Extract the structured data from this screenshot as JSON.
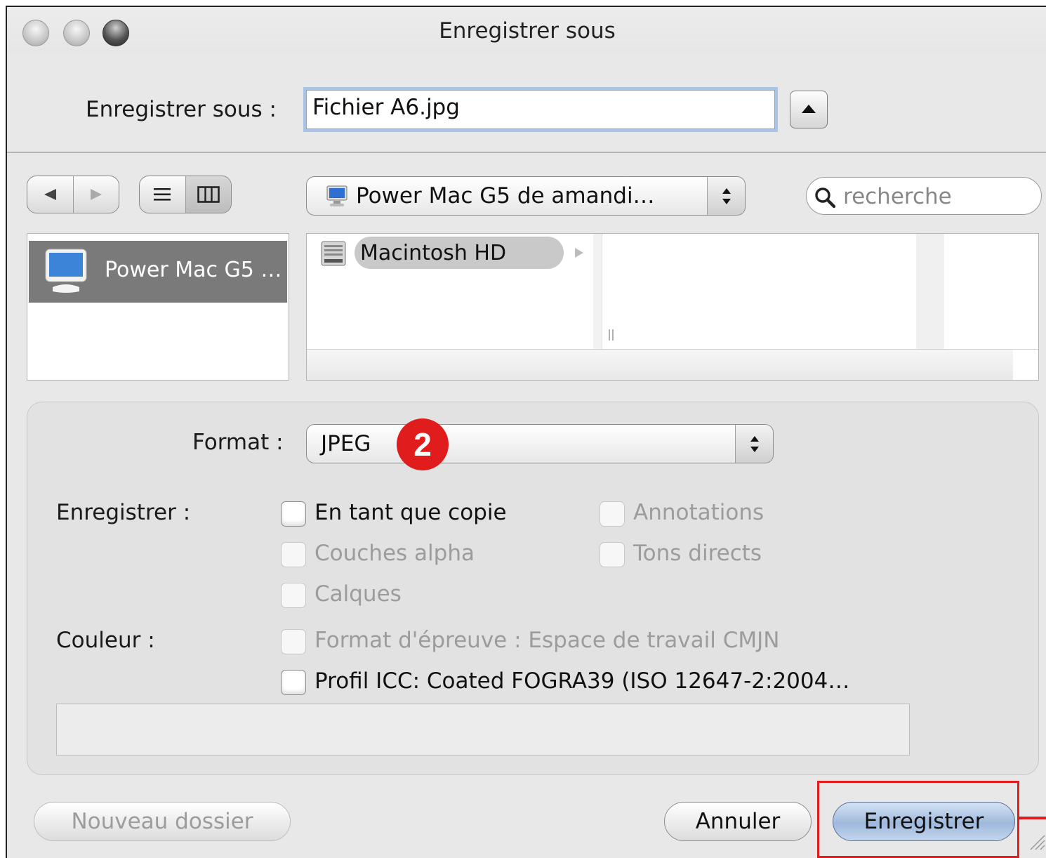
{
  "window": {
    "title": "Enregistrer sous"
  },
  "filename": {
    "label": "Enregistrer sous :",
    "value": "Fichier A6.jpg"
  },
  "location": {
    "value": "Power Mac G5 de amandi…"
  },
  "search": {
    "placeholder": "recherche"
  },
  "sidebar": {
    "items": [
      {
        "label": "Power Mac G5 …"
      }
    ]
  },
  "browser": {
    "columns": [
      {
        "items": [
          {
            "label": "Macintosh HD"
          }
        ]
      }
    ]
  },
  "format": {
    "label": "Format :",
    "value": "JPEG",
    "badge": "2"
  },
  "save_options": {
    "label": "Enregistrer :",
    "options": [
      {
        "label": "En tant que copie",
        "enabled": true,
        "checked": false
      },
      {
        "label": "Annotations",
        "enabled": false,
        "checked": false
      },
      {
        "label": "Couches alpha",
        "enabled": false,
        "checked": false
      },
      {
        "label": "Tons directs",
        "enabled": false,
        "checked": false
      },
      {
        "label": "Calques",
        "enabled": false,
        "checked": false
      }
    ]
  },
  "color": {
    "label": "Couleur :",
    "options": [
      {
        "label": "Format d'épreuve : Espace de travail CMJN",
        "enabled": false,
        "checked": false
      },
      {
        "label": "Profil ICC:  Coated FOGRA39 (ISO 12647-2:2004…",
        "enabled": true,
        "checked": false
      }
    ]
  },
  "buttons": {
    "new_folder": "Nouveau dossier",
    "cancel": "Annuler",
    "save": "Enregistrer"
  },
  "colors": {
    "annotation_red": "#e11c1c",
    "default_button_blue": "#9fb9dc"
  }
}
